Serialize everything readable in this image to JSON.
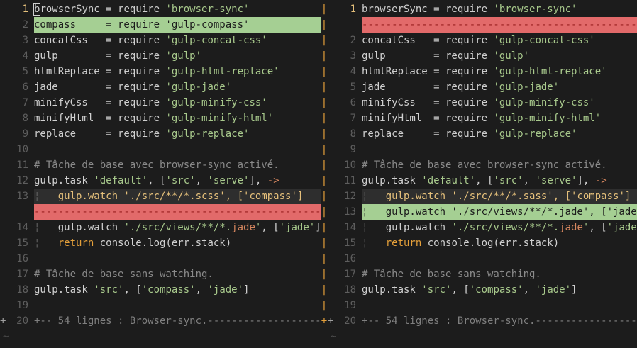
{
  "colors": {
    "background": "#1c1c1c",
    "diff_add": "#a5cf93",
    "diff_delete": "#e26a6a",
    "diff_change_line": "#2e2e2e",
    "separator": "#e5a03a",
    "string": "#a8c98c",
    "comment": "#8a8a8a",
    "keyword": "#e5a03a",
    "line_number": "#5e5e5e"
  },
  "left": {
    "lines": [
      {
        "n": "1",
        "cur": true,
        "kind": "normal",
        "segs": [
          {
            "t": "b"
          },
          {
            "t": "rowserSync = require "
          },
          {
            "t": "'browser-sync'",
            "c": "str"
          }
        ]
      },
      {
        "n": "2",
        "kind": "add",
        "segs": [
          {
            "t": "compass     = require 'gulp-compass'"
          }
        ]
      },
      {
        "n": "3",
        "kind": "normal",
        "segs": [
          {
            "t": "concatCss   = require "
          },
          {
            "t": "'gulp-concat-css'",
            "c": "str"
          }
        ]
      },
      {
        "n": "4",
        "kind": "normal",
        "segs": [
          {
            "t": "gulp        = require "
          },
          {
            "t": "'gulp'",
            "c": "str"
          }
        ]
      },
      {
        "n": "5",
        "kind": "normal",
        "segs": [
          {
            "t": "htmlReplace = require "
          },
          {
            "t": "'gulp-html-replace'",
            "c": "str"
          }
        ]
      },
      {
        "n": "6",
        "kind": "normal",
        "segs": [
          {
            "t": "jade        = require "
          },
          {
            "t": "'gulp-jade'",
            "c": "str"
          }
        ]
      },
      {
        "n": "7",
        "kind": "normal",
        "segs": [
          {
            "t": "minifyCss   = require "
          },
          {
            "t": "'gulp-minify-css'",
            "c": "str"
          }
        ]
      },
      {
        "n": "8",
        "kind": "normal",
        "segs": [
          {
            "t": "minifyHtml  = require "
          },
          {
            "t": "'gulp-minify-html'",
            "c": "str"
          }
        ]
      },
      {
        "n": "9",
        "kind": "normal",
        "segs": [
          {
            "t": "replace     = require "
          },
          {
            "t": "'gulp-replace'",
            "c": "str"
          }
        ]
      },
      {
        "n": "10",
        "kind": "normal",
        "segs": []
      },
      {
        "n": "11",
        "kind": "normal",
        "segs": [
          {
            "t": "# Tâche de base avec browser-sync activé.",
            "c": "cmt"
          }
        ]
      },
      {
        "n": "12",
        "kind": "normal",
        "segs": [
          {
            "t": "gulp.task "
          },
          {
            "t": "'default'",
            "c": "str"
          },
          {
            "t": ", ["
          },
          {
            "t": "'src'",
            "c": "str"
          },
          {
            "t": ", "
          },
          {
            "t": "'serve'",
            "c": "str"
          },
          {
            "t": "], "
          },
          {
            "t": "->",
            "c": "op"
          }
        ]
      },
      {
        "n": "13",
        "kind": "chg",
        "segs": [
          {
            "t": "¦   ",
            "c": "guide"
          },
          {
            "t": "gulp.watch './src/**/*.scss', ['compass']",
            "c": "hl-text"
          }
        ]
      },
      {
        "n": "",
        "kind": "del",
        "segs": [
          {
            "t": "------------------------------------------------------------"
          }
        ]
      },
      {
        "n": "14",
        "kind": "normal",
        "segs": [
          {
            "t": "¦   ",
            "c": "guide"
          },
          {
            "t": "gulp.watch "
          },
          {
            "t": "'./src/views/**/*.",
            "c": "str"
          },
          {
            "t": "jade",
            "c": "op"
          },
          {
            "t": "'",
            "c": "str"
          },
          {
            "t": ", ["
          },
          {
            "t": "'jade'",
            "c": "str"
          },
          {
            "t": "]"
          }
        ]
      },
      {
        "n": "15",
        "kind": "normal",
        "segs": [
          {
            "t": "¦   ",
            "c": "guide"
          },
          {
            "t": "return",
            "c": "kw"
          },
          {
            "t": " console.log(err.stack)"
          }
        ]
      },
      {
        "n": "16",
        "kind": "normal",
        "segs": []
      },
      {
        "n": "17",
        "kind": "normal",
        "segs": [
          {
            "t": "# Tâche de base sans watching.",
            "c": "cmt"
          }
        ]
      },
      {
        "n": "18",
        "kind": "normal",
        "segs": [
          {
            "t": "gulp.task "
          },
          {
            "t": "'src'",
            "c": "str"
          },
          {
            "t": ", ["
          },
          {
            "t": "'compass'",
            "c": "str"
          },
          {
            "t": ", "
          },
          {
            "t": "'jade'",
            "c": "str"
          },
          {
            "t": "]"
          }
        ]
      },
      {
        "n": "19",
        "kind": "normal",
        "segs": []
      },
      {
        "n": "20",
        "fold": "+",
        "kind": "fold-line",
        "segs": [
          {
            "t": "+-- 54 lignes : Browser-sync.----------------------"
          }
        ]
      },
      {
        "n": "",
        "kind": "tilde",
        "segs": [
          {
            "t": "~"
          }
        ]
      }
    ]
  },
  "right": {
    "lines": [
      {
        "n": "1",
        "cur": true,
        "kind": "normal",
        "segs": [
          {
            "t": "browserSync = require "
          },
          {
            "t": "'browser-sync'",
            "c": "str"
          }
        ]
      },
      {
        "n": "",
        "kind": "del",
        "segs": [
          {
            "t": "------------------------------------------------------------"
          }
        ]
      },
      {
        "n": "2",
        "kind": "normal",
        "segs": [
          {
            "t": "concatCss   = require "
          },
          {
            "t": "'gulp-concat-css'",
            "c": "str"
          }
        ]
      },
      {
        "n": "3",
        "kind": "normal",
        "segs": [
          {
            "t": "gulp        = require "
          },
          {
            "t": "'gulp'",
            "c": "str"
          }
        ]
      },
      {
        "n": "4",
        "kind": "normal",
        "segs": [
          {
            "t": "htmlReplace = require "
          },
          {
            "t": "'gulp-html-replace'",
            "c": "str"
          }
        ]
      },
      {
        "n": "5",
        "kind": "normal",
        "segs": [
          {
            "t": "jade        = require "
          },
          {
            "t": "'gulp-jade'",
            "c": "str"
          }
        ]
      },
      {
        "n": "6",
        "kind": "normal",
        "segs": [
          {
            "t": "minifyCss   = require "
          },
          {
            "t": "'gulp-minify-css'",
            "c": "str"
          }
        ]
      },
      {
        "n": "7",
        "kind": "normal",
        "segs": [
          {
            "t": "minifyHtml  = require "
          },
          {
            "t": "'gulp-minify-html'",
            "c": "str"
          }
        ]
      },
      {
        "n": "8",
        "kind": "normal",
        "segs": [
          {
            "t": "replace     = require "
          },
          {
            "t": "'gulp-replace'",
            "c": "str"
          }
        ]
      },
      {
        "n": "9",
        "kind": "normal",
        "segs": []
      },
      {
        "n": "10",
        "kind": "normal",
        "segs": [
          {
            "t": "# Tâche de base avec browser-sync activé.",
            "c": "cmt"
          }
        ]
      },
      {
        "n": "11",
        "kind": "normal",
        "segs": [
          {
            "t": "gulp.task "
          },
          {
            "t": "'default'",
            "c": "str"
          },
          {
            "t": ", ["
          },
          {
            "t": "'src'",
            "c": "str"
          },
          {
            "t": ", "
          },
          {
            "t": "'serve'",
            "c": "str"
          },
          {
            "t": "], "
          },
          {
            "t": "->",
            "c": "op"
          }
        ]
      },
      {
        "n": "12",
        "kind": "chg",
        "segs": [
          {
            "t": "¦   ",
            "c": "guide"
          },
          {
            "t": "gulp.watch './src/**/*.sass', ['compass']",
            "c": "hl-text"
          }
        ]
      },
      {
        "n": "13",
        "kind": "add",
        "segs": [
          {
            "t": "¦   gulp.watch './src/views/**/*.jade', ['jade']"
          }
        ]
      },
      {
        "n": "14",
        "kind": "normal",
        "segs": [
          {
            "t": "¦   ",
            "c": "guide"
          },
          {
            "t": "gulp.watch "
          },
          {
            "t": "'./src/views/**/*.",
            "c": "str"
          },
          {
            "t": "jade",
            "c": "op"
          },
          {
            "t": "'",
            "c": "str"
          },
          {
            "t": ", ["
          },
          {
            "t": "'jade'",
            "c": "str"
          },
          {
            "t": "]"
          }
        ]
      },
      {
        "n": "15",
        "kind": "normal",
        "segs": [
          {
            "t": "¦   ",
            "c": "guide"
          },
          {
            "t": "return",
            "c": "kw"
          },
          {
            "t": " console.log(err.stack)"
          }
        ]
      },
      {
        "n": "16",
        "kind": "normal",
        "segs": []
      },
      {
        "n": "17",
        "kind": "normal",
        "segs": [
          {
            "t": "# Tâche de base sans watching.",
            "c": "cmt"
          }
        ]
      },
      {
        "n": "18",
        "kind": "normal",
        "segs": [
          {
            "t": "gulp.task "
          },
          {
            "t": "'src'",
            "c": "str"
          },
          {
            "t": ", ["
          },
          {
            "t": "'compass'",
            "c": "str"
          },
          {
            "t": ", "
          },
          {
            "t": "'jade'",
            "c": "str"
          },
          {
            "t": "]"
          }
        ]
      },
      {
        "n": "19",
        "kind": "normal",
        "segs": []
      },
      {
        "n": "20",
        "fold": "+",
        "kind": "fold-line",
        "segs": [
          {
            "t": "+-- 54 lignes : Browser-sync.----------------------"
          }
        ]
      },
      {
        "n": "",
        "kind": "tilde",
        "segs": [
          {
            "t": "~"
          }
        ]
      }
    ]
  },
  "separator_chars": [
    "|",
    "+"
  ]
}
